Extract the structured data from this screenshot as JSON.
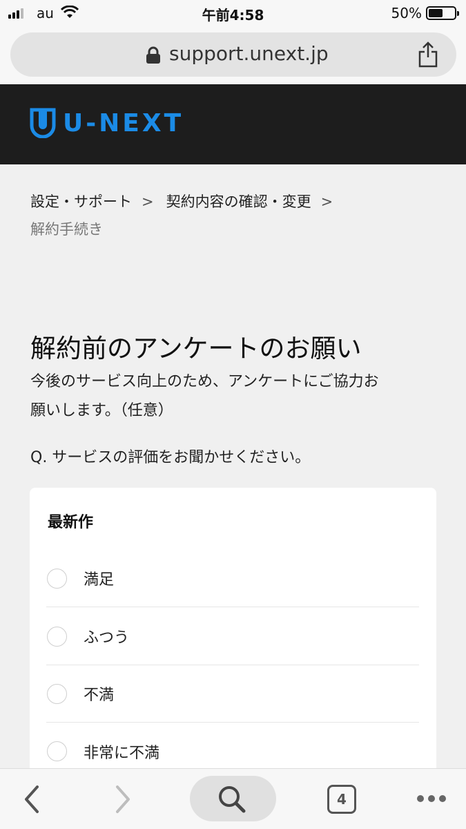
{
  "status": {
    "carrier": "au",
    "time": "午前4:58",
    "battery_text": "50%",
    "battery_level": 0.5
  },
  "browser": {
    "url": "support.unext.jp",
    "tab_count": "4"
  },
  "site": {
    "logo_text": "U-NEXT",
    "brand_color": "#1b8be6",
    "header_bg": "#1d1d1d"
  },
  "breadcrumb": {
    "items": [
      "設定・サポート",
      "契約内容の確認・変更"
    ],
    "separator": ">",
    "current": "解約手続き"
  },
  "survey": {
    "title": "解約前のアンケートのお願い",
    "description_line1": "今後のサービス向上のため、アンケートにご協力お",
    "description_line2": "願いします。（任意）",
    "question": "Q. サービスの評価をお聞かせください。",
    "card_title": "最新作",
    "options": [
      "満足",
      "ふつう",
      "不満",
      "非常に不満"
    ]
  },
  "icons": {
    "lock": "lock-icon",
    "share": "share-icon",
    "back": "chevron-left-icon",
    "forward": "chevron-right-icon",
    "search": "search-icon",
    "tabs": "tabs-icon",
    "more": "more-icon"
  }
}
